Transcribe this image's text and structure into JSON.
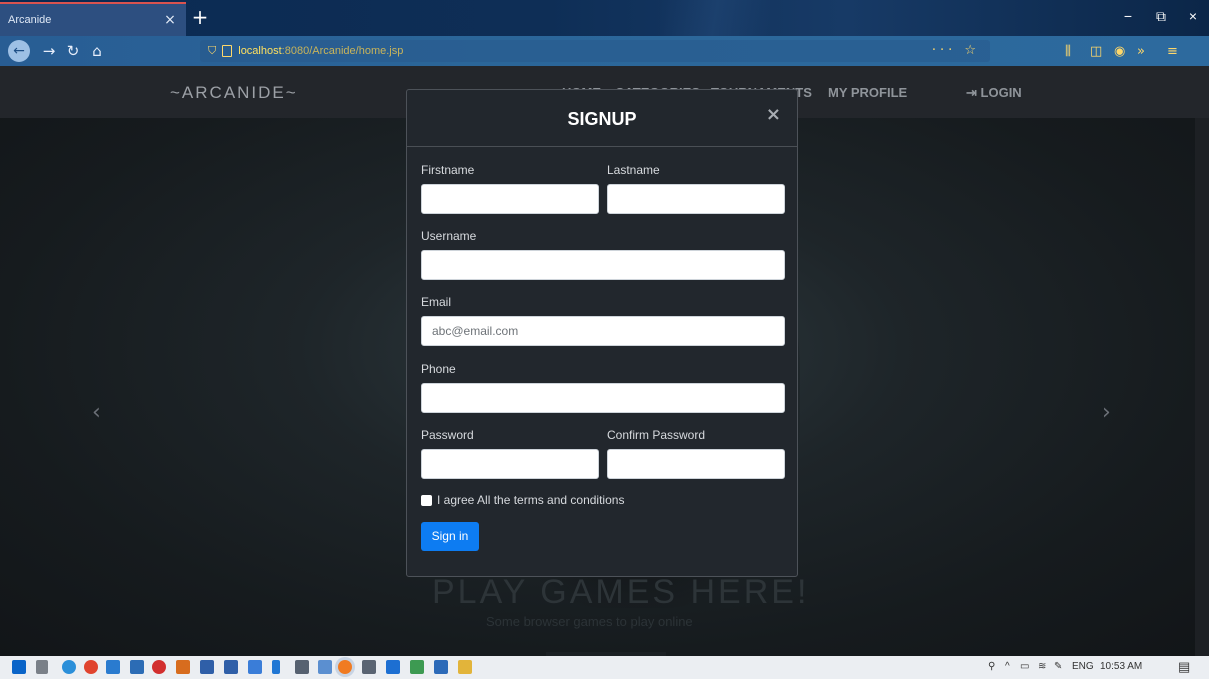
{
  "browser": {
    "tab_title": "Arcanide",
    "tab_close": "×",
    "new_tab": "+",
    "url_host": "localhost",
    "url_path": ":8080/Arcanide/home.jsp",
    "window_controls": [
      "−",
      "⧉",
      "×"
    ]
  },
  "site": {
    "logo": "~ARCANIDE~",
    "nav": [
      "HOME",
      "CATEGORIES",
      "TOURNAMENTS",
      "MY PROFILE"
    ],
    "login": "LOGIN",
    "hero_title": "PLAY GAMES HERE!",
    "hero_subtitle": "Some browser games to play online",
    "carousel_prev": "‹",
    "carousel_next": "›"
  },
  "modal": {
    "title": "SIGNUP",
    "close": "×",
    "firstname_label": "Firstname",
    "lastname_label": "Lastname",
    "username_label": "Username",
    "email_label": "Email",
    "email_placeholder": "abc@email.com",
    "phone_label": "Phone",
    "password_label": "Password",
    "confirm_label": "Confirm Password",
    "terms_label": "I agree All the terms and conditions",
    "submit_label": "Sign in"
  },
  "taskbar": {
    "language": "ENG",
    "time": "10:53 AM"
  },
  "colors": {
    "accent": "#0d7cf2",
    "modal_bg": "#22272d",
    "browser_bar": "#2b6699"
  }
}
